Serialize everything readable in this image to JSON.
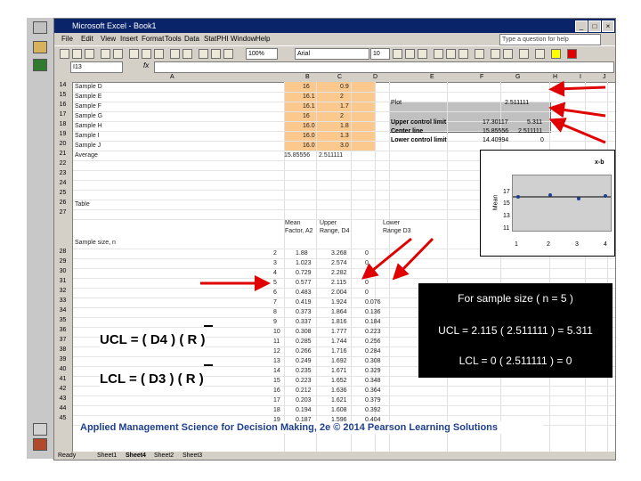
{
  "app": {
    "title": "Microsoft Excel - Book1",
    "help_placeholder": "Type a question for help"
  },
  "menu": [
    "File",
    "Edit",
    "View",
    "Insert",
    "Format",
    "Tools",
    "Data",
    "StatPHI",
    "Window",
    "Help"
  ],
  "toolbar": {
    "zoom": "100%",
    "font": "Arial",
    "font_size": "10"
  },
  "formula_bar": {
    "name_box": "I13",
    "fx": "fx"
  },
  "columns": [
    "A",
    "B",
    "C",
    "D",
    "E",
    "F",
    "G",
    "H",
    "I",
    "J"
  ],
  "rows": [
    {
      "n": "14",
      "a": "Sample D",
      "b": "16",
      "c": "0.9"
    },
    {
      "n": "15",
      "a": "Sample E",
      "b": "16.1",
      "c": "2"
    },
    {
      "n": "16",
      "a": "Sample F",
      "b": "16.1",
      "c": "1.7"
    },
    {
      "n": "17",
      "a": "Sample G",
      "b": "16",
      "c": "2"
    },
    {
      "n": "18",
      "a": "Sample H",
      "b": "16.0",
      "c": "1.8"
    },
    {
      "n": "19",
      "a": "Sample I",
      "b": "16.0",
      "c": "1.3"
    },
    {
      "n": "20",
      "a": "Sample J",
      "b": "16.0",
      "c": "3.0"
    },
    {
      "n": "21",
      "a": "Average",
      "b": "15.85556",
      "c": "2.511111"
    },
    {
      "n": "22",
      "a": "",
      "b": "",
      "c": ""
    },
    {
      "n": "23",
      "a": "",
      "b": "",
      "c": ""
    },
    {
      "n": "24",
      "a": "",
      "b": "",
      "c": ""
    },
    {
      "n": "25",
      "a": "",
      "b": "",
      "c": ""
    },
    {
      "n": "26",
      "a": "Table",
      "b": "",
      "c": ""
    },
    {
      "n": "27",
      "a": "",
      "b": "",
      "c": ""
    }
  ],
  "table_headers": {
    "b": "Mean Factor, A2",
    "c": "Upper Range, D4",
    "d": "Lower Range D3",
    "a": "Sample size, n"
  },
  "factor_rows": [
    {
      "n": "28",
      "size": "2",
      "a2": "1.88",
      "d4": "3.268",
      "d3": "0"
    },
    {
      "n": "29",
      "size": "3",
      "a2": "1.023",
      "d4": "2.574",
      "d3": "0"
    },
    {
      "n": "30",
      "size": "4",
      "a2": "0.729",
      "d4": "2.282",
      "d3": "0"
    },
    {
      "n": "31",
      "size": "5",
      "a2": "0.577",
      "d4": "2.115",
      "d3": "0"
    },
    {
      "n": "32",
      "size": "6",
      "a2": "0.483",
      "d4": "2.004",
      "d3": "0"
    },
    {
      "n": "33",
      "size": "7",
      "a2": "0.419",
      "d4": "1.924",
      "d3": "0.076"
    },
    {
      "n": "34",
      "size": "8",
      "a2": "0.373",
      "d4": "1.864",
      "d3": "0.136"
    },
    {
      "n": "35",
      "size": "9",
      "a2": "0.337",
      "d4": "1.816",
      "d3": "0.184"
    },
    {
      "n": "36",
      "size": "10",
      "a2": "0.308",
      "d4": "1.777",
      "d3": "0.223"
    },
    {
      "n": "37",
      "size": "11",
      "a2": "0.285",
      "d4": "1.744",
      "d3": "0.256"
    },
    {
      "n": "38",
      "size": "12",
      "a2": "0.266",
      "d4": "1.716",
      "d3": "0.284"
    },
    {
      "n": "39",
      "size": "13",
      "a2": "0.249",
      "d4": "1.692",
      "d3": "0.308"
    },
    {
      "n": "40",
      "size": "14",
      "a2": "0.235",
      "d4": "1.671",
      "d3": "0.329"
    },
    {
      "n": "41",
      "size": "15",
      "a2": "0.223",
      "d4": "1.652",
      "d3": "0.348"
    },
    {
      "n": "42",
      "size": "16",
      "a2": "0.212",
      "d4": "1.636",
      "d3": "0.364"
    },
    {
      "n": "43",
      "size": "17",
      "a2": "0.203",
      "d4": "1.621",
      "d3": "0.379"
    },
    {
      "n": "44",
      "size": "18",
      "a2": "0.194",
      "d4": "1.608",
      "d3": "0.392"
    },
    {
      "n": "45",
      "size": "19",
      "a2": "0.187",
      "d4": "1.596",
      "d3": "0.404"
    }
  ],
  "side_panel": {
    "plot": {
      "label": "Plot",
      "value": "2.511111"
    },
    "ucl": {
      "label": "Upper control limit",
      "x": "17.30117",
      "r": "5.311"
    },
    "center": {
      "label": "Center line",
      "x": "15.85556",
      "r": "2.511111"
    },
    "lcl": {
      "label": "Lower control limit",
      "x": "14.40994",
      "r": "0"
    }
  },
  "chart_data": {
    "type": "line",
    "title": "x-b",
    "ylabel": "Mean",
    "x": [
      1,
      2,
      3,
      4
    ],
    "yticks": [
      "17",
      "15",
      "13",
      "11"
    ],
    "xticks": [
      "1",
      "2",
      "3",
      "4"
    ]
  },
  "sheet_tabs": [
    "Sheet1",
    "Sheet4",
    "Sheet2",
    "Sheet3"
  ],
  "status": "Ready",
  "footer": "Applied Management Science for Decision Making, 2e © 2014 Pearson Learning Solutions",
  "formulas": {
    "ucl": "UCL = ( D4 ) ( R )",
    "lcl": "LCL = ( D3 ) ( R )"
  },
  "black_box": {
    "heading": "For sample size ( n = 5 )",
    "ucl": "UCL = 2.115 ( 2.511111 ) = 5.311",
    "lcl": "LCL = 0 ( 2.511111 ) = 0"
  },
  "colors": {
    "arrow": "#e00000",
    "highlight": "#fbc88e"
  }
}
